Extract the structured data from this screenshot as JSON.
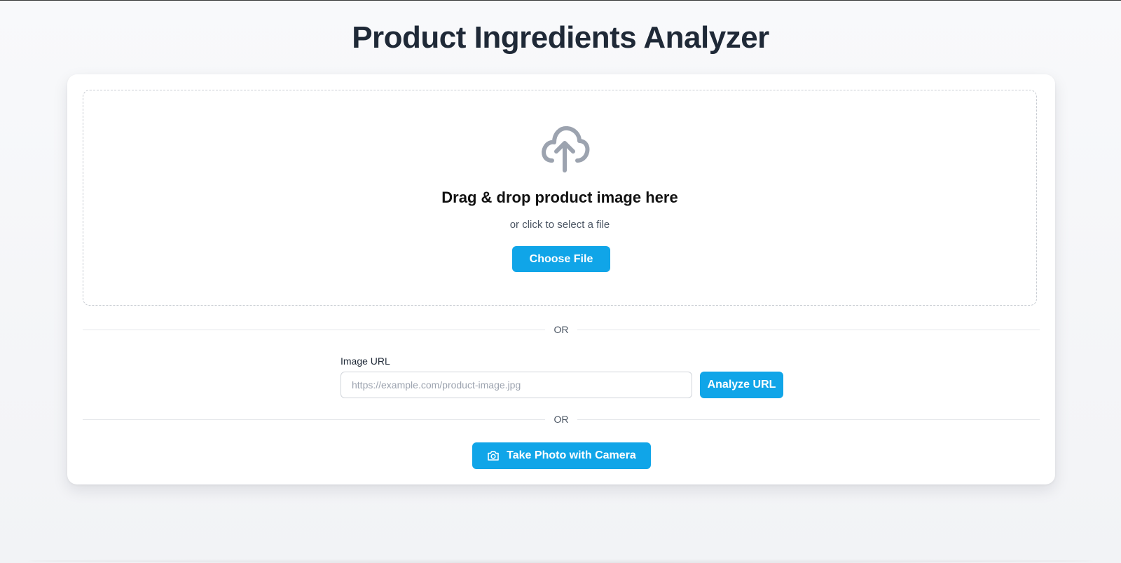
{
  "header": {
    "title": "Product Ingredients Analyzer"
  },
  "upload": {
    "icon": "cloud-upload-icon",
    "title": "Drag & drop product image here",
    "subtitle": "or click to select a file",
    "choose_file_label": "Choose File"
  },
  "dividers": {
    "first": "OR",
    "second": "OR"
  },
  "url_section": {
    "label": "Image URL",
    "placeholder": "https://example.com/product-image.jpg",
    "value": "",
    "analyze_label": "Analyze URL"
  },
  "camera": {
    "icon": "camera-icon",
    "label": "Take Photo with Camera"
  },
  "colors": {
    "primary": "#10a5e8",
    "title_text": "#1f2937",
    "muted_text": "#4b5563",
    "icon_gray": "#9ca3af"
  }
}
